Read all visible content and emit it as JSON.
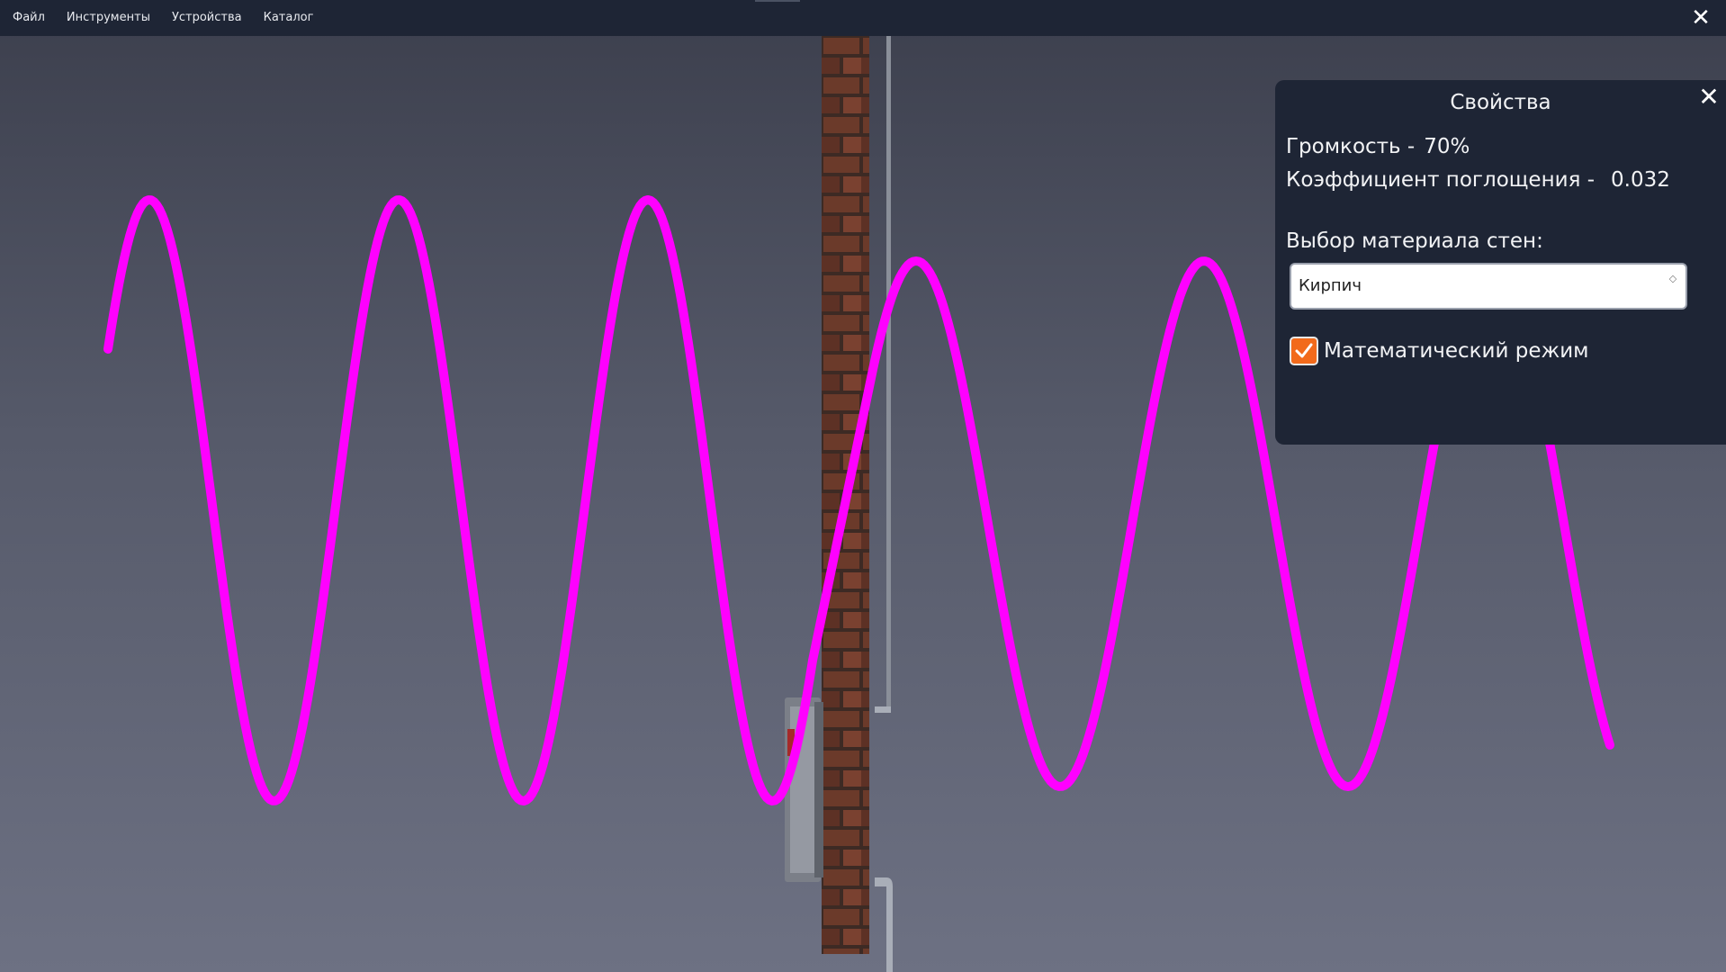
{
  "menubar": {
    "items": [
      "Файл",
      "Инструменты",
      "Устройства",
      "Каталог"
    ],
    "close_icon": "close-icon"
  },
  "panel": {
    "title": "Свойства",
    "volume_label": "Громкость -",
    "volume_value": "70%",
    "absorption_label": "Коэффициент поглощения -",
    "absorption_value": "0.032",
    "material_label": "Выбор материала стен:",
    "material_selected": "Кирпич",
    "math_mode_label": "Математический режим",
    "math_mode_checked": true
  },
  "colors": {
    "wave": "#ff00ff",
    "menubar_bg": "#1e2535",
    "panel_bg": "#1e2535",
    "checkbox_accent": "#f26a1b",
    "brick": "#6b3a2a"
  },
  "icons": [
    "close-icon",
    "checkmark-icon",
    "select-arrows-icon"
  ]
}
